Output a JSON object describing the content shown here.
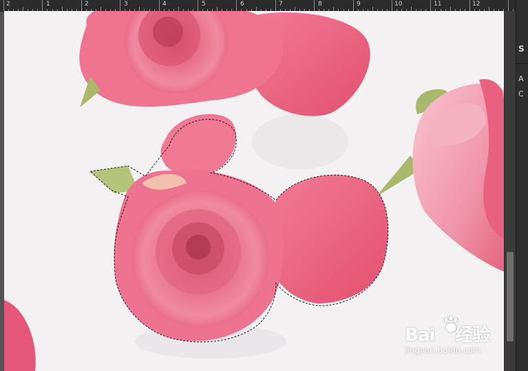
{
  "ruler": {
    "labels": [
      "2",
      "1",
      "2",
      "3",
      "4",
      "5",
      "6",
      "7",
      "8",
      "9",
      "10",
      "11",
      "12"
    ]
  },
  "panel": {
    "tabs": [
      "S"
    ],
    "letters": [
      "A",
      "C"
    ]
  },
  "watermark": {
    "logo": "Bai",
    "logo_suffix": "经验",
    "site": "jingyan.baidu.com"
  },
  "colors": {
    "canvas_bg": "#f3f1f2",
    "rose_dark": "#d9406a",
    "rose_mid": "#ec6f8f",
    "rose_light": "#f6a8bb",
    "leaf": "#a9b86a"
  }
}
